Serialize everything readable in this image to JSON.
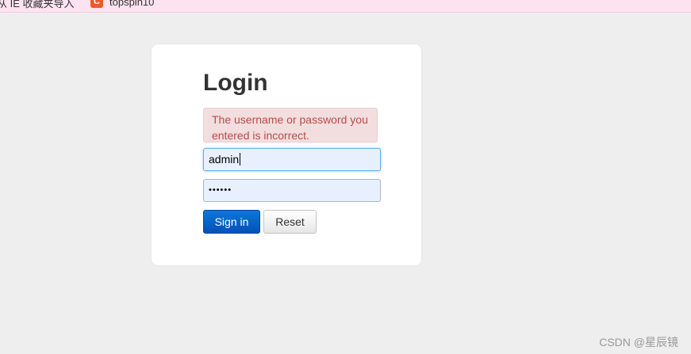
{
  "bookmarks": {
    "item1": "从 IE 收藏夹导入",
    "item2": "topspin10",
    "item2_icon": "csdn-icon",
    "item2_icon_glyph": "C"
  },
  "login": {
    "title": "Login",
    "error": "The username or password you entered is incorrect.",
    "username_value": "admin",
    "password_mask": "••••••",
    "sign_in_label": "Sign in",
    "reset_label": "Reset"
  },
  "watermark": "CSDN @星辰镜",
  "colors": {
    "page_bg": "#eeeeee",
    "bookmarks_bg": "#fde3ef",
    "alert_bg": "#f2dede",
    "alert_text": "#b94a48",
    "input_bg": "#e8f0fe",
    "primary": "#0450b8"
  }
}
